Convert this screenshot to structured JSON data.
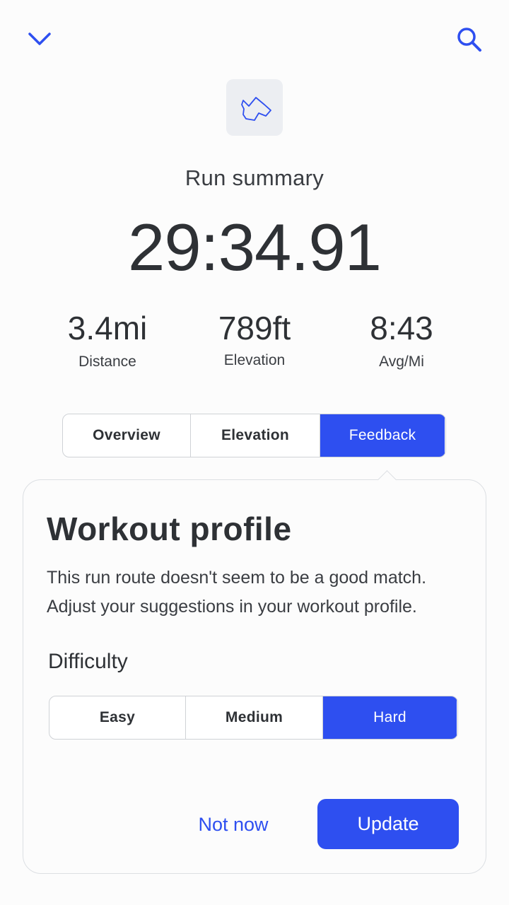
{
  "header": {
    "back_icon": "chevron-down-icon",
    "search_icon": "search-icon"
  },
  "route": {
    "icon": "route-map-icon"
  },
  "summary": {
    "title": "Run summary",
    "total_time": "29:34.91",
    "stats": [
      {
        "value": "3.4mi",
        "label": "Distance"
      },
      {
        "value": "789ft",
        "label": "Elevation"
      },
      {
        "value": "8:43",
        "label": "Avg/Mi"
      }
    ]
  },
  "tabs": {
    "items": [
      {
        "label": "Overview"
      },
      {
        "label": "Elevation"
      },
      {
        "label": "Feedback"
      }
    ],
    "selected": "Feedback"
  },
  "feedback_card": {
    "title": "Workout profile",
    "description": "This run route doesn't seem to be a good match. Adjust your suggestions in your workout profile.",
    "difficulty_label": "Difficulty",
    "difficulty_options": [
      {
        "label": "Easy"
      },
      {
        "label": "Medium"
      },
      {
        "label": "Hard"
      }
    ],
    "difficulty_selected": "Hard",
    "not_now_label": "Not now",
    "update_label": "Update"
  },
  "colors": {
    "accent": "#2e4ff0",
    "text": "#2e3135",
    "border": "#cfd2d6"
  }
}
